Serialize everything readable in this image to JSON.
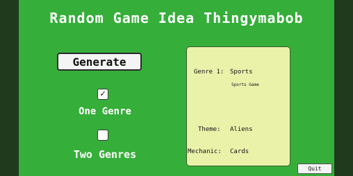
{
  "app": {
    "title": "Random Game Idea Thingymabob"
  },
  "controls": {
    "generate_label": "Generate",
    "one_genre": {
      "label": "One Genre",
      "checked": true,
      "mark": "✓"
    },
    "two_genres": {
      "label": "Two Genres",
      "checked": false,
      "mark": ""
    },
    "quit_label": "Quit"
  },
  "result": {
    "genre_label": "Genre 1:",
    "genre_value": "Sports",
    "genre_description": "Sports Game",
    "theme_label": "Theme:",
    "theme_value": "Aliens",
    "mechanic_label": "Mechanic:",
    "mechanic_value": "Cards"
  },
  "colors": {
    "background": "#36ae3a",
    "panel": "#eaf2aa",
    "button": "#f4f4f4"
  }
}
